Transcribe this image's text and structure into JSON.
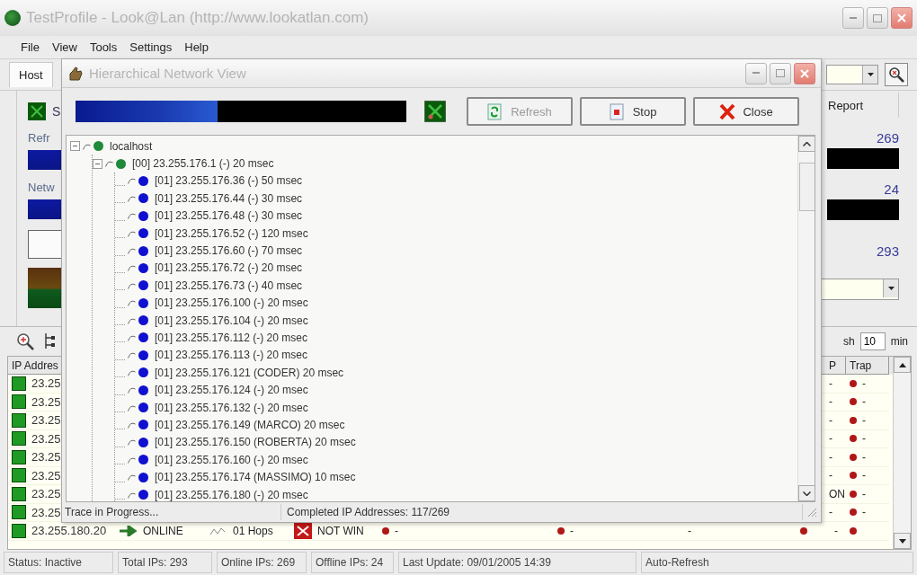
{
  "window": {
    "title": "TestProfile - Look@Lan (http://www.lookatlan.com)"
  },
  "menu": [
    "File",
    "View",
    "Tools",
    "Settings",
    "Help"
  ],
  "host_tab": {
    "label": "Host",
    "selected": true
  },
  "left_panel": {
    "heading": "S",
    "items": [
      {
        "kind": "label",
        "text": "Refr"
      },
      {
        "kind": "bar"
      },
      {
        "kind": "label",
        "text": "Netw"
      },
      {
        "kind": "bar"
      },
      {
        "kind": "box"
      },
      {
        "kind": "meter"
      }
    ]
  },
  "right_panel": {
    "tab": "Report",
    "stats": [
      "269",
      "24",
      "293"
    ]
  },
  "auto_refresh": {
    "label": "sh",
    "value": "10",
    "unit": "min"
  },
  "table": {
    "header": {
      "ip": "IP Addres",
      "p": "P",
      "trap": "Trap"
    },
    "rows": [
      {
        "ip": "23.25",
        "p": "-",
        "trap": "-"
      },
      {
        "ip": "23.25",
        "p": "-",
        "trap": "-"
      },
      {
        "ip": "23.25",
        "p": "-",
        "trap": "-"
      },
      {
        "ip": "23.25",
        "p": "-",
        "trap": "-"
      },
      {
        "ip": "23.25",
        "p": "-",
        "trap": "-"
      },
      {
        "ip": "23.25",
        "p": "-",
        "trap": "-"
      },
      {
        "ip": "23.25",
        "p": "ON",
        "trap": "-"
      },
      {
        "ip": "23.25",
        "p": "-",
        "trap": "-"
      },
      {
        "ip": "23.255.180.20",
        "state": "ONLINE",
        "hops": "01 Hops",
        "name": "NOT WIN",
        "col_5": "-",
        "col_6": "-",
        "col_7": "-",
        "p": "-",
        "p_dot": true
      }
    ]
  },
  "status_bar": [
    "Status: Inactive",
    "Total IPs: 293",
    "Online IPs: 269",
    "Offline IPs: 24",
    "Last Update: 09/01/2005 14:39",
    "Auto-Refresh"
  ],
  "dialog": {
    "title": "Hierarchical Network View",
    "progress": {
      "level": 0.43
    },
    "buttons": [
      {
        "kind": "refresh",
        "label": "Refresh",
        "disabled": true
      },
      {
        "kind": "stop",
        "label": "Stop",
        "disabled": false
      },
      {
        "kind": "close",
        "label": "Close",
        "disabled": false
      }
    ],
    "tree": [
      {
        "label": "localhost",
        "color": "#1e8a3a",
        "expanded": true,
        "children": [
          {
            "label": "[00] 23.255.176.1 (-) 20 msec",
            "color": "#1e8a3a",
            "expanded": true,
            "children": [
              {
                "label": "[01] 23.255.176.36 (-) 50 msec",
                "color": "#1010d0"
              },
              {
                "label": "[01] 23.255.176.44 (-) 30 msec",
                "color": "#1010d0"
              },
              {
                "label": "[01] 23.255.176.48 (-) 30 msec",
                "color": "#1010d0"
              },
              {
                "label": "[01] 23.255.176.52 (-) 120 msec",
                "color": "#1010d0"
              },
              {
                "label": "[01] 23.255.176.60 (-) 70 msec",
                "color": "#1010d0"
              },
              {
                "label": "[01] 23.255.176.72 (-) 20 msec",
                "color": "#1010d0"
              },
              {
                "label": "[01] 23.255.176.73 (-) 40 msec",
                "color": "#1010d0"
              },
              {
                "label": "[01] 23.255.176.100 (-) 20 msec",
                "color": "#1010d0"
              },
              {
                "label": "[01] 23.255.176.104 (-) 20 msec",
                "color": "#1010d0"
              },
              {
                "label": "[01] 23.255.176.112 (-) 20 msec",
                "color": "#1010d0"
              },
              {
                "label": "[01] 23.255.176.113 (-) 20 msec",
                "color": "#1010d0"
              },
              {
                "label": "[01] 23.255.176.121 (CODER) 20 msec",
                "color": "#1010d0"
              },
              {
                "label": "[01] 23.255.176.124 (-) 20 msec",
                "color": "#1010d0"
              },
              {
                "label": "[01] 23.255.176.132 (-) 20 msec",
                "color": "#1010d0"
              },
              {
                "label": "[01] 23.255.176.149 (MARCO) 20 msec",
                "color": "#1010d0"
              },
              {
                "label": "[01] 23.255.176.150 (ROBERTA) 20 msec",
                "color": "#1010d0"
              },
              {
                "label": "[01] 23.255.176.160 (-) 20 msec",
                "color": "#1010d0"
              },
              {
                "label": "[01] 23.255.176.174 (MASSIMO) 10 msec",
                "color": "#1010d0"
              },
              {
                "label": "[01] 23.255.176.180 (-) 20 msec",
                "color": "#1010d0"
              }
            ]
          }
        ]
      }
    ],
    "status": [
      "Trace in Progress...",
      "Completed IP Addresses: 117/269"
    ]
  }
}
